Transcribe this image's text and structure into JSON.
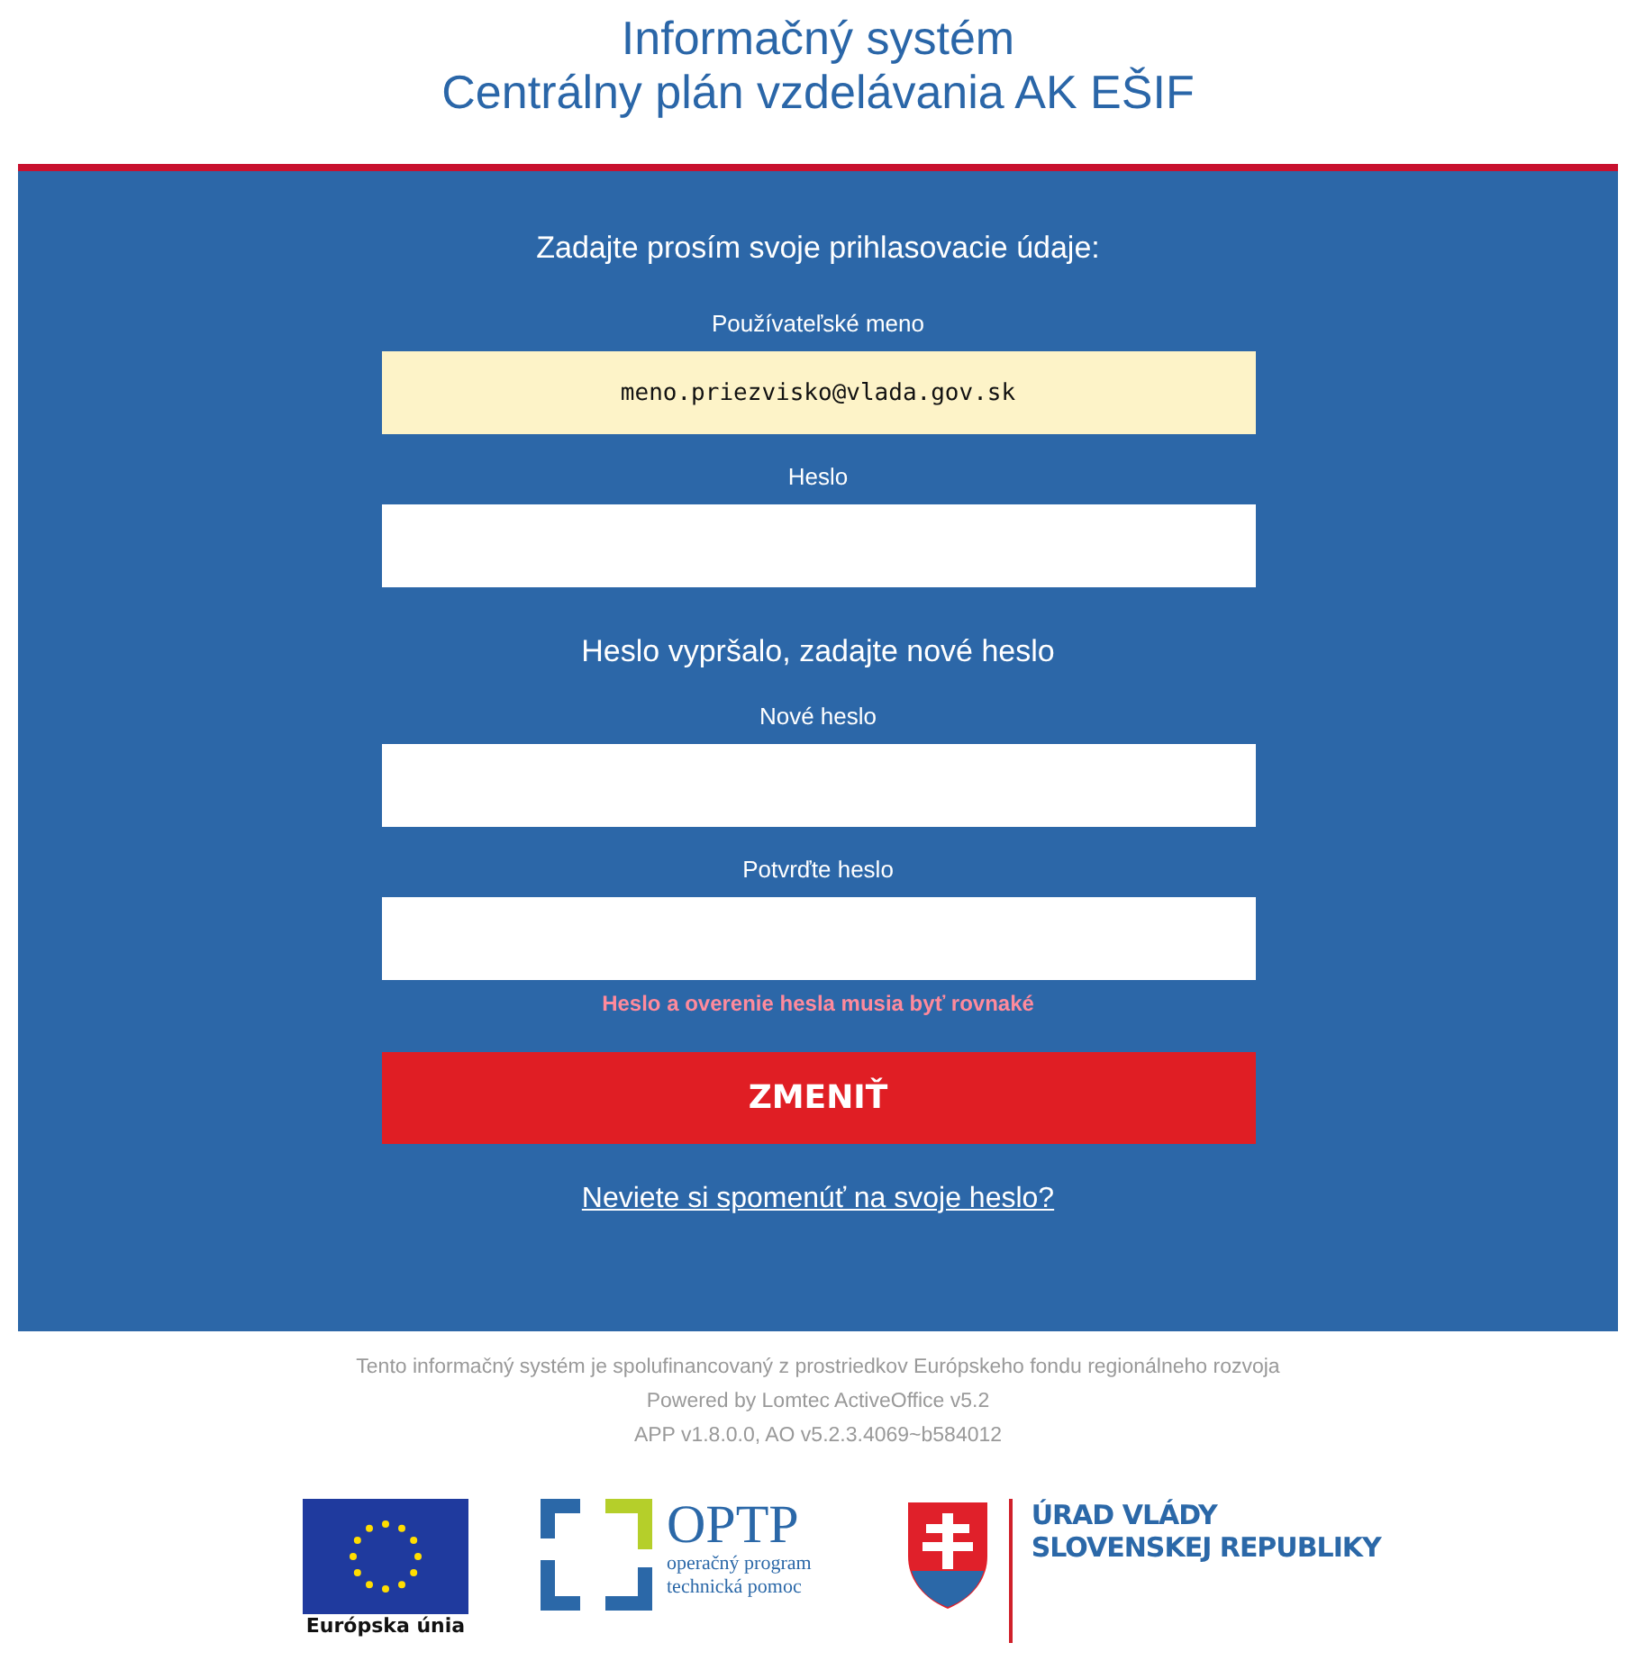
{
  "header": {
    "title_lines": [
      "Informačný systém",
      "Centrálny plán vzdelávania AK EŠIF"
    ]
  },
  "login": {
    "prompt": "Zadajte prosím svoje prihlasovacie údaje:",
    "fields": [
      {
        "label": "Používateľské meno",
        "value": "meno.priezvisko@vlada.gov.sk",
        "autofilled": true
      },
      {
        "label": "Heslo",
        "autofilled": false
      }
    ],
    "expired_notice": "Heslo vypršalo, zadajte nové heslo",
    "new_fields": [
      {
        "label": "Nové heslo",
        "autofilled": false
      },
      {
        "label": "Potvrďte heslo",
        "autofilled": false
      }
    ],
    "error": "Heslo a overenie hesla musia byť rovnaké",
    "submit_button": "ZMENIŤ",
    "forgot_link": "Neviete si spomenúť na svoje heslo?"
  },
  "footer": {
    "lines": [
      "Tento informačný systém je spolufinancovaný z prostriedkov Európskeho fondu regionálneho rozvoja",
      "Powered by Lomtec ActiveOffice v5.2",
      "APP v1.8.0.0, AO v5.2.3.4069~b584012"
    ]
  },
  "logos": {
    "eu_caption": "Európska únia",
    "optp_title": "OPTP",
    "optp_lines": [
      "operačný program",
      "technická pomoc"
    ],
    "gov_lines": [
      "ÚRAD VLÁDY",
      "SLOVENSKEJ REPUBLIKY"
    ]
  }
}
